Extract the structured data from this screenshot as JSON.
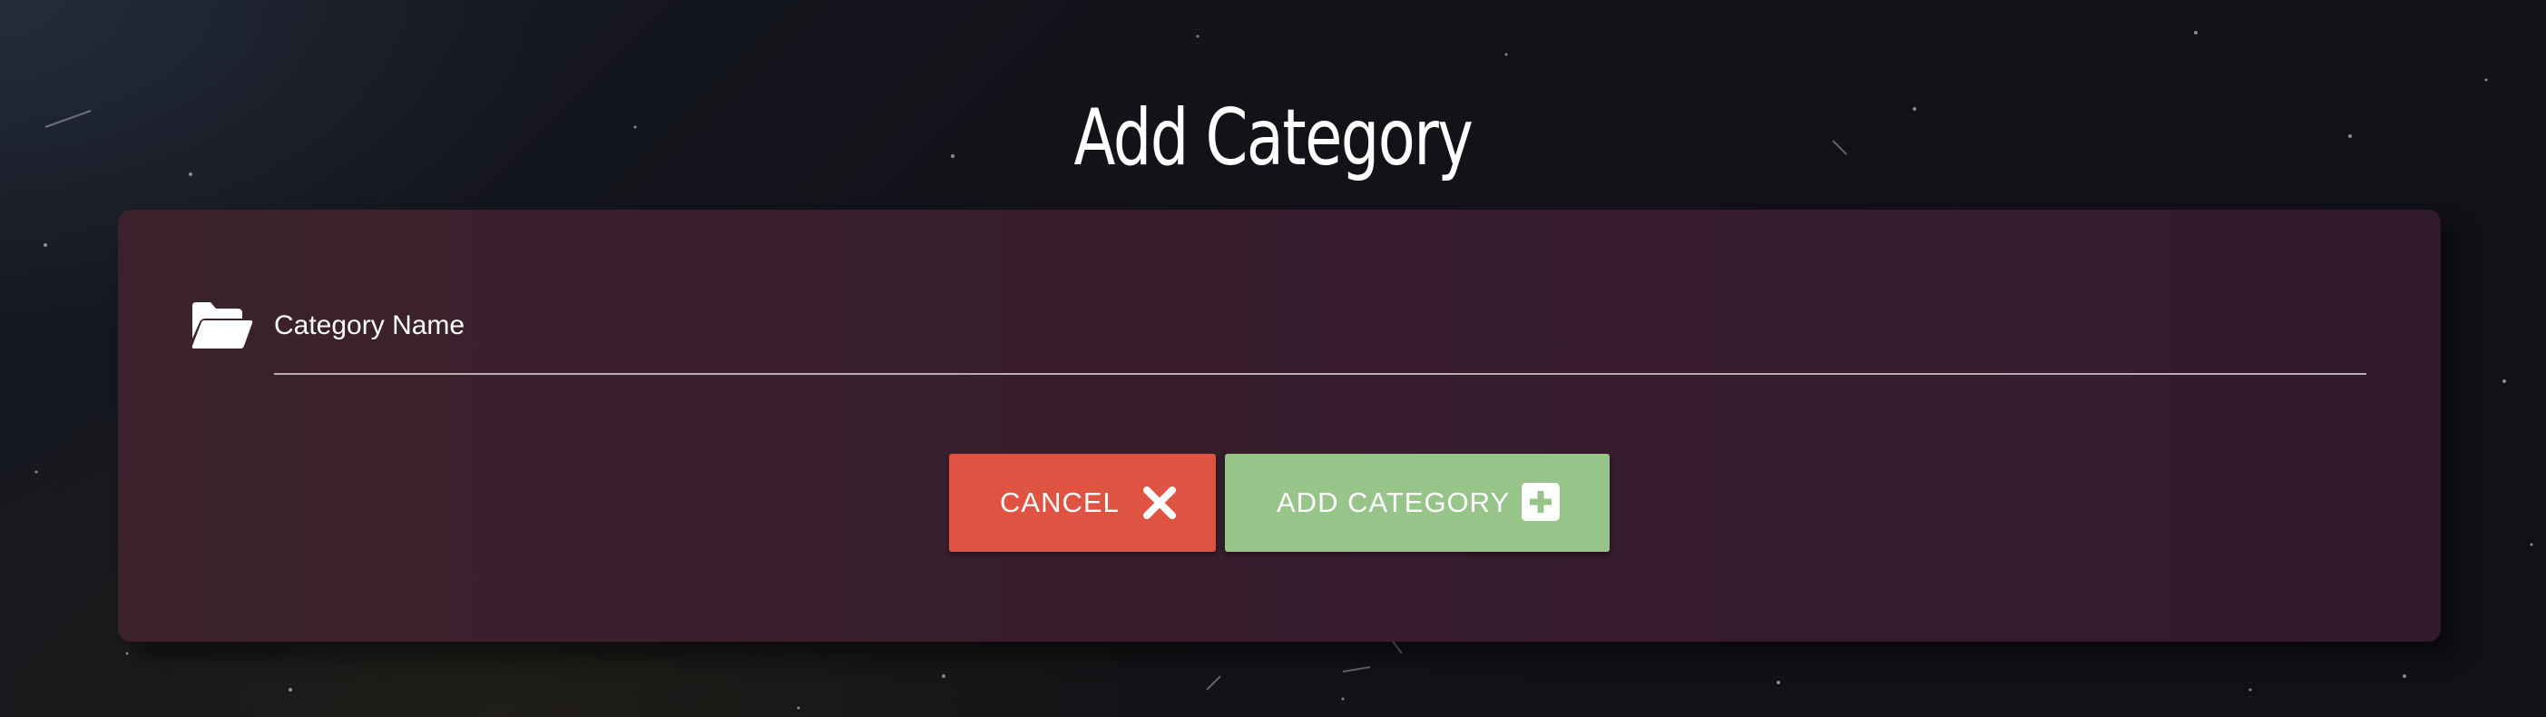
{
  "page": {
    "title": "Add Category"
  },
  "form": {
    "category_field": {
      "icon": "folder-open-icon",
      "label": "Category Name",
      "value": ""
    }
  },
  "actions": {
    "cancel": {
      "label": "CANCEL",
      "icon": "close-icon",
      "color": "#de5341"
    },
    "add": {
      "label": "ADD CATEGORY",
      "icon": "plus-square-icon",
      "color": "#97c489"
    }
  },
  "theme": {
    "card_background": "#371d2d",
    "page_background": "#121218",
    "text_color": "#ffffff"
  }
}
